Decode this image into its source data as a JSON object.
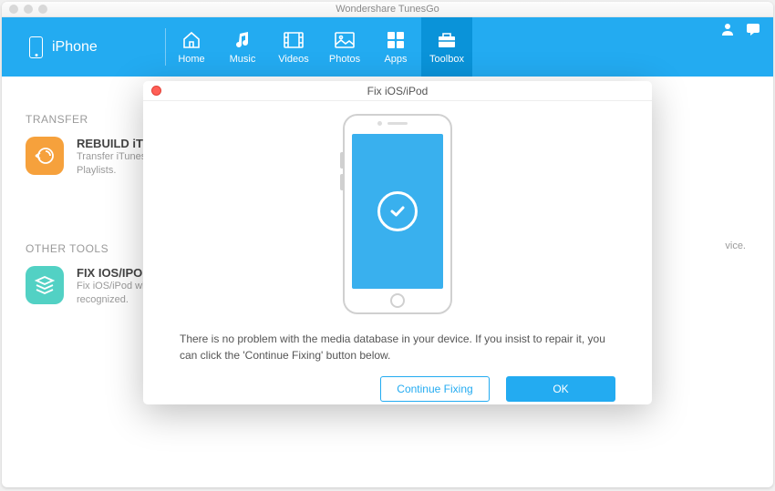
{
  "app": {
    "title": "Wondershare TunesGo"
  },
  "device": {
    "name": "iPhone"
  },
  "nav": {
    "items": [
      {
        "id": "home",
        "label": "Home"
      },
      {
        "id": "music",
        "label": "Music"
      },
      {
        "id": "videos",
        "label": "Videos"
      },
      {
        "id": "photos",
        "label": "Photos"
      },
      {
        "id": "apps",
        "label": "Apps"
      },
      {
        "id": "toolbox",
        "label": "Toolbox"
      }
    ],
    "active": "toolbox"
  },
  "sections": {
    "transfer": {
      "title": "TRANSFER",
      "card": {
        "heading": "REBUILD iTUNES LIBRARY",
        "sub1": "Transfer iTunes media from iPhone, iPad, iPod & Android device.",
        "sub2": "Playlists."
      }
    },
    "other": {
      "title": "OTHER TOOLS",
      "card": {
        "heading": "FIX IOS/IPOD",
        "sub1": "Fix iOS/iPod when it can't be",
        "sub2": "recognized."
      }
    },
    "rightSuffix": "vice."
  },
  "modal": {
    "title": "Fix iOS/iPod",
    "message": "There is no problem with the media database in your device. If you insist to repair it, you can click the 'Continue Fixing' button below.",
    "continueLabel": "Continue Fixing",
    "okLabel": "OK"
  }
}
